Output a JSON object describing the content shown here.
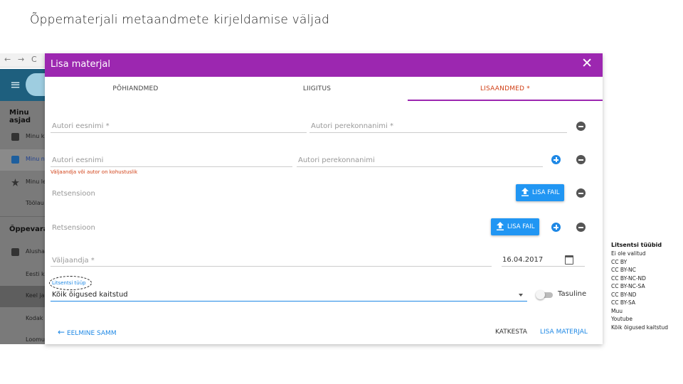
{
  "slide": {
    "title": "Õppematerjali metaandmete kirjeldamise väljad"
  },
  "browser": {
    "back": "←",
    "forward": "→",
    "reload": "C"
  },
  "sidebar": {
    "section1": "Minu asjad",
    "items1": [
      {
        "label": "Minu k",
        "icon": "document-icon"
      },
      {
        "label": "Minu n",
        "icon": "page-icon"
      },
      {
        "label": "Minu le",
        "icon": "star-icon"
      },
      {
        "label": "Töölau",
        "icon": ""
      }
    ],
    "section2": "Õppevara",
    "items2": [
      {
        "label": "Alusha",
        "icon": "puzzle-icon"
      },
      {
        "label": "Eesti k"
      },
      {
        "label": "Keel ja"
      },
      {
        "label": "Kodak"
      },
      {
        "label": "Loomu"
      }
    ]
  },
  "dialog": {
    "title": "Lisa materjal",
    "close": "✕",
    "tabs": [
      "PÕHIANDMED",
      "LIIGITUS",
      "LISAANDMED *"
    ],
    "active_tab": 2,
    "author1": {
      "first": "Autori eesnimi *",
      "last": "Autori perekonnanimi *"
    },
    "author2": {
      "first": "Autori eesnimi",
      "last": "Autori perekonnanimi",
      "error": "Väljaandja või autor on kohustuslik"
    },
    "review1": {
      "label": "Retsensioon",
      "button": "LISA FAIL"
    },
    "review2": {
      "label": "Retsensioon",
      "button": "LISA FAIL"
    },
    "publisher": {
      "label": "Väljaandja *",
      "date": "16.04.2017"
    },
    "license": {
      "label": "Litsentsi tüüp",
      "value": "Kõik õigused kaitstud",
      "toggle_label": "Tasuline",
      "toggle_on": false
    },
    "footer": {
      "back": "EELMINE SAMM",
      "cancel": "KATKESTA",
      "submit": "LISA MATERJAL"
    },
    "colors": {
      "header": "#9c27b0",
      "accent": "#2196f3",
      "active_tab": "#d14016",
      "error": "#d14016"
    }
  },
  "license_list": {
    "title": "Litsentsi tüübid",
    "items": [
      "Ei ole valitud",
      "CC BY",
      "CC BY-NC",
      "CC BY-NC-ND",
      "CC BY-NC-SA",
      "CC BY-ND",
      "CC BY-SA",
      "Muu",
      "Youtube",
      "Kõik õigused kaitstud"
    ]
  }
}
